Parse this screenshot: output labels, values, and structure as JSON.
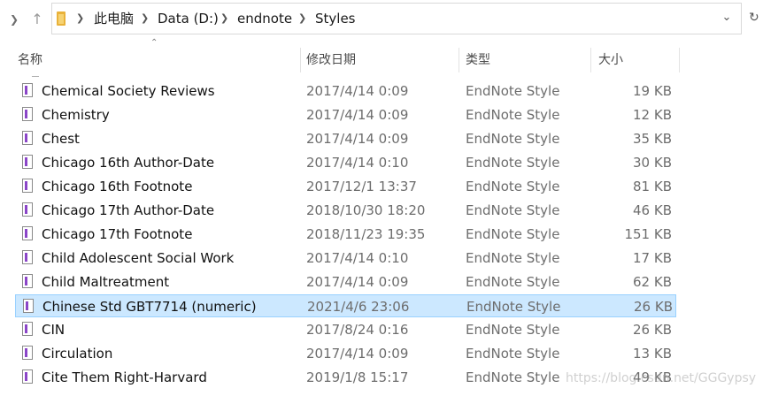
{
  "address_bar": {
    "crumbs": [
      "此电脑",
      "Data (D:)",
      "endnote",
      "Styles"
    ]
  },
  "columns": {
    "name": "名称",
    "date": "修改日期",
    "type": "类型",
    "size": "大小"
  },
  "files": [
    {
      "name": "Chemical Society Reviews",
      "date": "2017/4/14 0:09",
      "type": "EndNote Style",
      "size": "19 KB"
    },
    {
      "name": "Chemistry",
      "date": "2017/4/14 0:09",
      "type": "EndNote Style",
      "size": "12 KB"
    },
    {
      "name": "Chest",
      "date": "2017/4/14 0:09",
      "type": "EndNote Style",
      "size": "35 KB"
    },
    {
      "name": "Chicago 16th Author-Date",
      "date": "2017/4/14 0:10",
      "type": "EndNote Style",
      "size": "30 KB"
    },
    {
      "name": "Chicago 16th Footnote",
      "date": "2017/12/1 13:37",
      "type": "EndNote Style",
      "size": "81 KB"
    },
    {
      "name": "Chicago 17th Author-Date",
      "date": "2018/10/30 18:20",
      "type": "EndNote Style",
      "size": "46 KB"
    },
    {
      "name": "Chicago 17th Footnote",
      "date": "2018/11/23 19:35",
      "type": "EndNote Style",
      "size": "151 KB"
    },
    {
      "name": "Child Adolescent Social Work",
      "date": "2017/4/14 0:10",
      "type": "EndNote Style",
      "size": "17 KB"
    },
    {
      "name": "Child Maltreatment",
      "date": "2017/4/14 0:09",
      "type": "EndNote Style",
      "size": "62 KB"
    },
    {
      "name": "Chinese Std GBT7714 (numeric)",
      "date": "2021/4/6 23:06",
      "type": "EndNote Style",
      "size": "26 KB",
      "selected": true
    },
    {
      "name": "CIN",
      "date": "2017/8/24 0:16",
      "type": "EndNote Style",
      "size": "26 KB"
    },
    {
      "name": "Circulation",
      "date": "2017/4/14 0:09",
      "type": "EndNote Style",
      "size": "13 KB"
    },
    {
      "name": "Cite Them Right-Harvard",
      "date": "2019/1/8 15:17",
      "type": "EndNote Style",
      "size": "49 KB"
    }
  ],
  "watermark": "https://blog.csdn.net/GGGypsy",
  "colors": {
    "selection_bg": "#cce8ff",
    "selection_border": "#99d1ff",
    "icon_accent": "#8b45c8"
  }
}
